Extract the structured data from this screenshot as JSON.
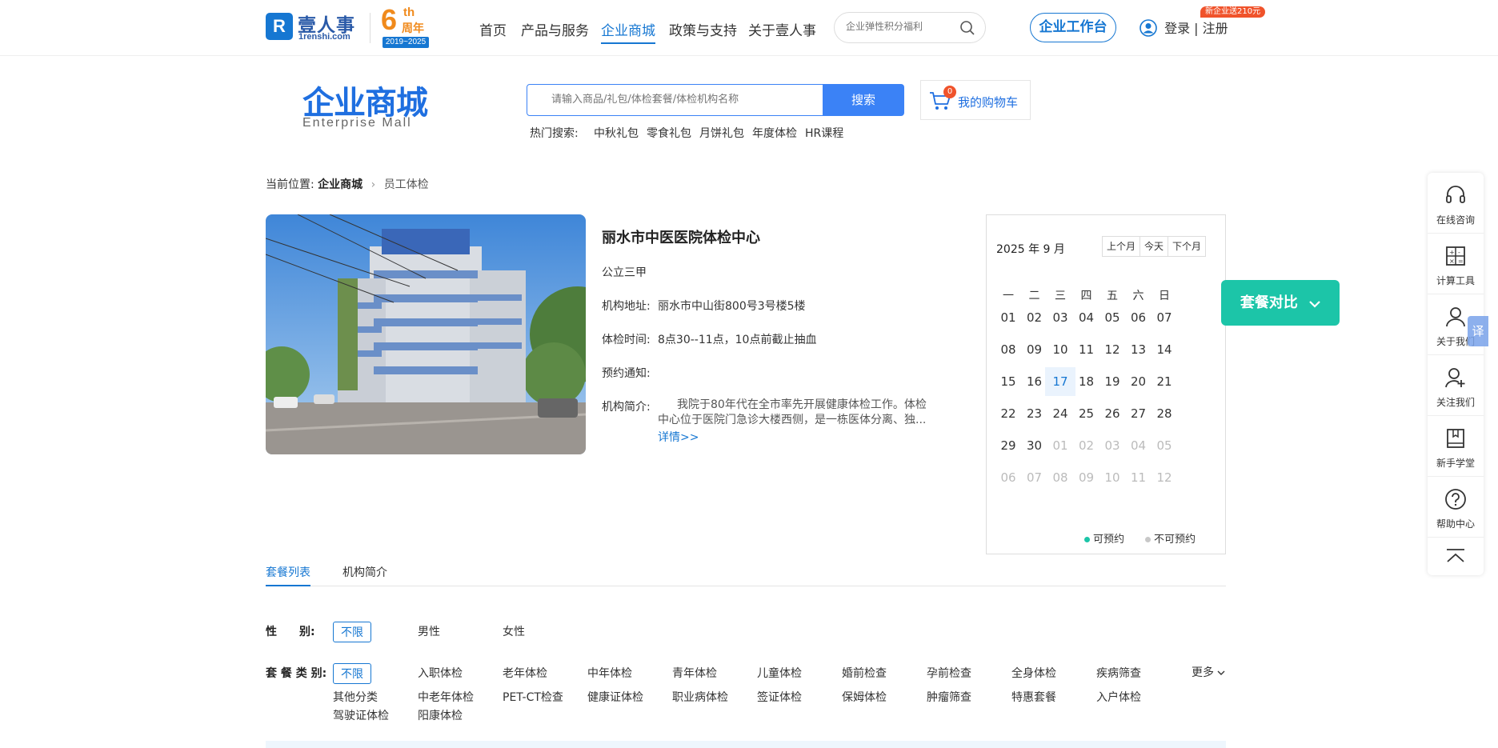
{
  "header": {
    "logo_letter": "R",
    "logo_text": "壹人事",
    "logo_domain": "1renshi.com",
    "anniv_num": "6",
    "anniv_th": "th",
    "anniv_label": "周年",
    "anniv_years": "2019~2025",
    "nav": [
      "首页",
      "产品与服务",
      "企业商城",
      "政策与支持",
      "关于壹人事"
    ],
    "nav_active_index": 2,
    "search_placeholder": "企业弹性积分福利",
    "workbench": "企业工作台",
    "login": "登录 | 注册",
    "promo": "新企业送210元"
  },
  "mall": {
    "title": "企业商城",
    "subtitle": "Enterprise  Mall",
    "search_placeholder": "请输入商品/礼包/体检套餐/体检机构名称",
    "search_button": "搜索",
    "hot_label": "热门搜索:",
    "hot_terms": [
      "中秋礼包",
      "零食礼包",
      "月饼礼包",
      "年度体检",
      "HR课程"
    ],
    "cart_count": "0",
    "cart_label": "我的购物车"
  },
  "breadcrumb": {
    "label": "当前位置:",
    "level1": "企业商城",
    "level2": "员工体检"
  },
  "institution": {
    "name": "丽水市中医医院体检中心",
    "grade": "公立三甲",
    "address_label": "机构地址:",
    "address": "丽水市中山街800号3号楼5楼",
    "hours_label": "体检时间:",
    "hours": "8点30--11点，10点前截止抽血",
    "notice_label": "预约通知:",
    "notice": "",
    "intro_label": "机构简介:",
    "intro": "我院于80年代在全市率先开展健康体检工作。体检中心位于医院门急诊大楼西侧，是一栋医体分离、独...",
    "detail_link": "详情>>"
  },
  "calendar": {
    "title": "2025 年 9 月",
    "buttons": [
      "上个月",
      "今天",
      "下个月"
    ],
    "weekdays": [
      "一",
      "二",
      "三",
      "四",
      "五",
      "六",
      "日"
    ],
    "weeks": [
      [
        "01",
        "02",
        "03",
        "04",
        "05",
        "06",
        "07"
      ],
      [
        "08",
        "09",
        "10",
        "11",
        "12",
        "13",
        "14"
      ],
      [
        "15",
        "16",
        "17",
        "18",
        "19",
        "20",
        "21"
      ],
      [
        "22",
        "23",
        "24",
        "25",
        "26",
        "27",
        "28"
      ],
      [
        "29",
        "30",
        "01",
        "02",
        "03",
        "04",
        "05"
      ],
      [
        "06",
        "07",
        "08",
        "09",
        "10",
        "11",
        "12"
      ]
    ],
    "today": "17",
    "available_label": "可预约",
    "unavailable_label": "不可预约",
    "available_color": "#1cc5a8",
    "unavailable_color": "#c8c8c8"
  },
  "compare": {
    "label": "套餐对比"
  },
  "sidebar": {
    "items": [
      "在线咨询",
      "计算工具",
      "关于我们",
      "关注我们",
      "新手学堂",
      "帮助中心"
    ],
    "translate": "译"
  },
  "tabs": [
    "套餐列表",
    "机构简介"
  ],
  "filters": {
    "gender_label": "性　　别:",
    "gender_options": [
      "不限",
      "男性",
      "女性"
    ],
    "category_label": "套 餐 类 别:",
    "category_options": [
      "不限",
      "入职体检",
      "老年体检",
      "中年体检",
      "青年体检",
      "儿童体检",
      "婚前检查",
      "孕前检查",
      "全身体检",
      "疾病筛查",
      "其他分类",
      "中老年体检",
      "PET-CT检查",
      "健康证体检",
      "职业病体检",
      "签证体检",
      "保姆体检",
      "肿瘤筛查",
      "特惠套餐",
      "入户体检",
      "驾驶证体检",
      "阳康体检"
    ],
    "more": "更多"
  },
  "colors": {
    "brand": "#1677d2",
    "accent": "#3b82f6",
    "teal": "#1cc5a8",
    "promo": "#f0532b",
    "orange": "#f08a1c"
  }
}
